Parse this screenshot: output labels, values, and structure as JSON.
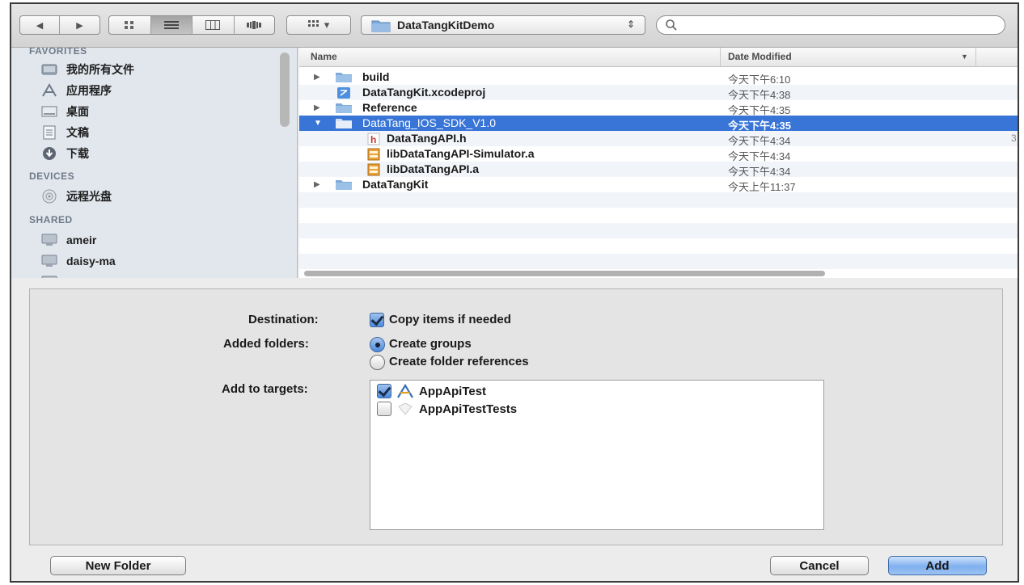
{
  "toolbar": {
    "nav_back_label": "◀",
    "nav_forward_label": "▶",
    "arrange_caret": "▾",
    "location_label": "DataTangKitDemo",
    "location_caret": "⇕",
    "search_value": ""
  },
  "sidebar": {
    "favorites_title": "FAVORITES",
    "favorites": [
      {
        "label": "我的所有文件",
        "icon": "all-files-icon"
      },
      {
        "label": "应用程序",
        "icon": "applications-icon"
      },
      {
        "label": "桌面",
        "icon": "desktop-icon"
      },
      {
        "label": "文稿",
        "icon": "documents-icon"
      },
      {
        "label": "下载",
        "icon": "downloads-icon"
      }
    ],
    "devices_title": "DEVICES",
    "devices": [
      {
        "label": "远程光盘",
        "icon": "remote-disc-icon"
      }
    ],
    "shared_title": "SHARED",
    "shared": [
      {
        "label": "ameir",
        "icon": "computer-icon"
      },
      {
        "label": "daisy-ma",
        "icon": "computer-icon"
      }
    ]
  },
  "filelist": {
    "col_name": "Name",
    "col_date": "Date Modified",
    "rows": [
      {
        "name": "build",
        "date": "今天下午6:10",
        "type": "folder",
        "indent": 0,
        "expand": "collapsed"
      },
      {
        "name": "DataTangKit.xcodeproj",
        "date": "今天下午4:38",
        "type": "xcodeproj",
        "indent": 0,
        "expand": "none"
      },
      {
        "name": "Reference",
        "date": "今天下午4:35",
        "type": "folder",
        "indent": 0,
        "expand": "collapsed"
      },
      {
        "name": "DataTang_IOS_SDK_V1.0",
        "date": "今天下午4:35",
        "type": "folder",
        "indent": 0,
        "expand": "expanded",
        "selected": true
      },
      {
        "name": "DataTangAPI.h",
        "date": "今天下午4:34",
        "type": "header",
        "indent": 1,
        "expand": "none",
        "extra": "3"
      },
      {
        "name": "libDataTangAPI-Simulator.a",
        "date": "今天下午4:34",
        "type": "library",
        "indent": 1,
        "expand": "none"
      },
      {
        "name": "libDataTangAPI.a",
        "date": "今天下午4:34",
        "type": "library",
        "indent": 1,
        "expand": "none"
      },
      {
        "name": "DataTangKit",
        "date": "今天上午11:37",
        "type": "folder",
        "indent": 0,
        "expand": "collapsed"
      }
    ]
  },
  "options": {
    "destination_label": "Destination:",
    "copy_items_label": "Copy items if needed",
    "copy_items_checked": true,
    "added_folders_label": "Added folders:",
    "create_groups_label": "Create groups",
    "create_folder_refs_label": "Create folder references",
    "selected_folder_option": "Create groups",
    "add_to_targets_label": "Add to targets:",
    "targets": [
      {
        "name": "AppApiTest",
        "checked": true,
        "icon": "app-target-icon"
      },
      {
        "name": "AppApiTestTests",
        "checked": false,
        "icon": "test-target-icon"
      }
    ]
  },
  "buttons": {
    "new_folder": "New Folder",
    "cancel": "Cancel",
    "add": "Add"
  },
  "colors": {
    "selection": "#3875d7",
    "sidebar_bg": "#e2e7ee",
    "folder": "#7fa9d8"
  }
}
